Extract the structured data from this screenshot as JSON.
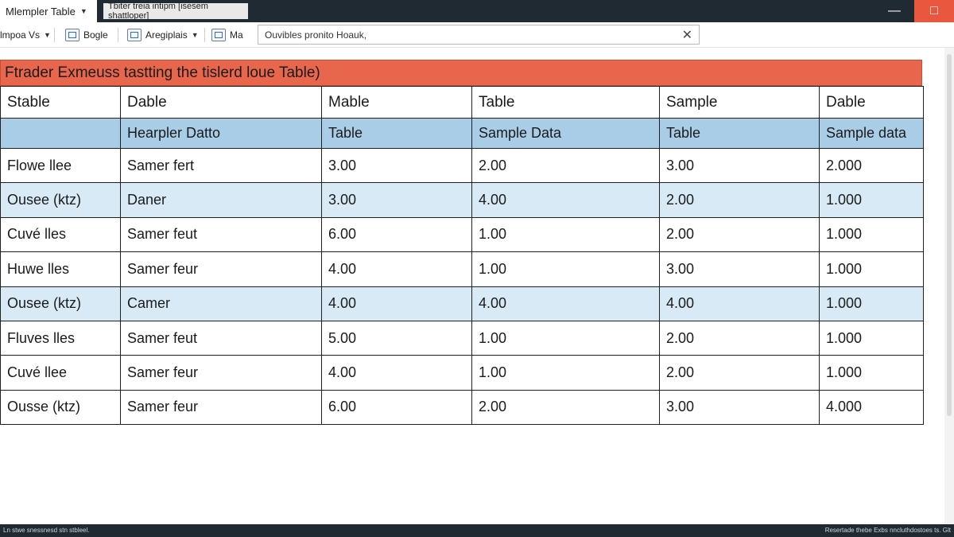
{
  "window": {
    "tab_title": "Mlempler Table",
    "doc_label": "Tbiter treia intipm  [isesem shattloper]",
    "minimize_glyph": "—",
    "close_glyph": "□"
  },
  "toolbar": {
    "item1": "lmpoa Vs",
    "item2": "Bogle",
    "item3": "Aregiplais",
    "item4": "Mа",
    "search_value": "Ouvibles pronito Hoauk,",
    "search_clear": "✕",
    "icons": [
      "document-icon",
      "grid-icon",
      "window-icon"
    ]
  },
  "table": {
    "banner": "Ftrader Exmeuss tastting the tislerd loue Table)",
    "header": [
      "Stable",
      "Dable",
      "Mable",
      "Table",
      "Sample",
      "Dable"
    ],
    "subheader": [
      "",
      "Hearpler Datto",
      "Table",
      "Sample Data",
      "Table",
      "Sample data"
    ],
    "rows": [
      [
        "Flowe llee",
        "Samer fert",
        "3.00",
        "2.00",
        "3.00",
        "2.000"
      ],
      [
        "Ousee (ktz)",
        "Daner",
        "3.00",
        "4.00",
        "2.00",
        "1.000"
      ],
      [
        "Cuvé lles",
        "Samer feut",
        "6.00",
        "1.00",
        "2.00",
        "1.000"
      ],
      [
        "Huwe lles",
        "Samer feur",
        "4.00",
        "1.00",
        "3.00",
        "1.000"
      ],
      [
        "Ousee (ktz)",
        "Camer",
        "4.00",
        "4.00",
        "4.00",
        "1.000"
      ],
      [
        "Fluves lles",
        "Samer feut",
        "5.00",
        "1.00",
        "2.00",
        "1.000"
      ],
      [
        "Cuvé llee",
        "Samer feur",
        "4.00",
        "1.00",
        "2.00",
        "1.000"
      ],
      [
        "Ousse (ktz)",
        "Samer feur",
        "6.00",
        "2.00",
        "3.00",
        "4.000"
      ]
    ],
    "alt_rows": [
      1,
      4
    ]
  },
  "status": {
    "left": "Ln stwe snessnesd stn stbleel.",
    "right": "Resertade thebe Exbs nncluthdostoes ts. Glt"
  },
  "colors": {
    "banner": "#e8674c",
    "subheader": "#a9cde6",
    "alt_row": "#d8eaf5",
    "chrome_dark": "#1f2a33",
    "close": "#e9573f"
  }
}
